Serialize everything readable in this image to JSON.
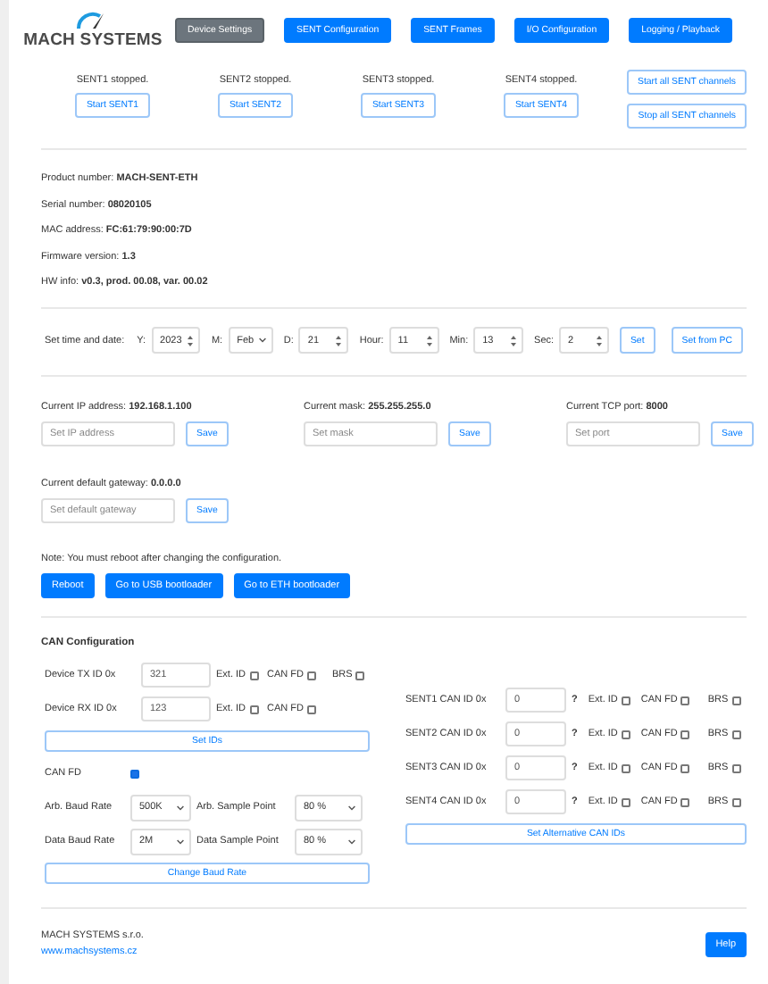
{
  "logo": {
    "name": "MACH SYSTEMS"
  },
  "nav": [
    {
      "label": "Device Settings",
      "selected": true
    },
    {
      "label": "SENT Configuration",
      "selected": false
    },
    {
      "label": "SENT Frames",
      "selected": false
    },
    {
      "label": "I/O Configuration",
      "selected": false
    },
    {
      "label": "Logging / Playback",
      "selected": false
    }
  ],
  "channels": [
    {
      "status": "SENT1 stopped.",
      "button": "Start SENT1"
    },
    {
      "status": "SENT2 stopped.",
      "button": "Start SENT2"
    },
    {
      "status": "SENT3 stopped.",
      "button": "Start SENT3"
    },
    {
      "status": "SENT4 stopped.",
      "button": "Start SENT4"
    }
  ],
  "all_buttons": [
    "Start all SENT channels",
    "Stop all SENT channels"
  ],
  "info": [
    {
      "label": "Product number:",
      "value": "MACH-SENT-ETH"
    },
    {
      "label": "Serial number:",
      "value": "08020105"
    },
    {
      "label": "MAC address:",
      "value": "FC:61:79:90:00:7D"
    },
    {
      "label": "Firmware version:",
      "value": "1.3"
    },
    {
      "label": "HW info:",
      "value": "v0.3, prod. 00.08, var. 00.02"
    }
  ],
  "time": {
    "label": "Set time and date:",
    "fields": [
      {
        "label": "Y:",
        "value": "2023",
        "kind": "number"
      },
      {
        "label": "M:",
        "value": "Feb",
        "kind": "select"
      },
      {
        "label": "D:",
        "value": "21",
        "kind": "number"
      },
      {
        "label": "Hour:",
        "value": "11",
        "kind": "number"
      },
      {
        "label": "Min:",
        "value": "13",
        "kind": "number"
      },
      {
        "label": "Sec:",
        "value": "2",
        "kind": "number"
      }
    ],
    "buttons": [
      "Set",
      "Set from PC"
    ]
  },
  "network": [
    {
      "label": "Current IP address:",
      "value": "192.168.1.100",
      "placeholder": "Set IP address",
      "button": "Save"
    },
    {
      "label": "Current mask:",
      "value": "255.255.255.0",
      "placeholder": "Set mask",
      "button": "Save"
    },
    {
      "label": "Current TCP port:",
      "value": "8000",
      "placeholder": "Set port",
      "button": "Save"
    }
  ],
  "gateway": {
    "label": "Current default gateway:",
    "value": "0.0.0.0",
    "placeholder": "Set default gateway",
    "button": "Save"
  },
  "note": "Note: You must reboot after changing the configuration.",
  "actions": [
    "Reboot",
    "Go to USB bootloader",
    "Go to ETH bootloader"
  ],
  "can": {
    "title": "CAN Configuration",
    "device_ids": [
      {
        "label": "Device TX ID 0x",
        "value": "321",
        "checks": [
          {
            "label": "Ext. ID",
            "checked": false
          },
          {
            "label": "CAN FD",
            "checked": false
          },
          {
            "label": "BRS",
            "checked": false
          }
        ]
      },
      {
        "label": "Device RX ID 0x",
        "value": "123",
        "checks": [
          {
            "label": "Ext. ID",
            "checked": false
          },
          {
            "label": "CAN FD",
            "checked": false
          }
        ]
      }
    ],
    "set_ids": "Set IDs",
    "can_fd": {
      "label": "CAN FD",
      "checked": true
    },
    "rates": [
      {
        "label": "Arb. Baud Rate",
        "value": "500K",
        "point_label": "Arb. Sample Point",
        "point": "80 %"
      },
      {
        "label": "Data Baud Rate",
        "value": "2M",
        "point_label": "Data Sample Point",
        "point": "80 %"
      }
    ],
    "change_rate": "Change Baud Rate",
    "sent_ids": [
      {
        "label": "SENT1 CAN ID 0x",
        "value": "0",
        "help": "?",
        "checks": [
          {
            "label": "Ext. ID",
            "checked": false
          },
          {
            "label": "CAN FD",
            "checked": false
          },
          {
            "label": "BRS",
            "checked": false
          }
        ]
      },
      {
        "label": "SENT2 CAN ID 0x",
        "value": "0",
        "help": "?",
        "checks": [
          {
            "label": "Ext. ID",
            "checked": false
          },
          {
            "label": "CAN FD",
            "checked": false
          },
          {
            "label": "BRS",
            "checked": false
          }
        ]
      },
      {
        "label": "SENT3 CAN ID 0x",
        "value": "0",
        "help": "?",
        "checks": [
          {
            "label": "Ext. ID",
            "checked": false
          },
          {
            "label": "CAN FD",
            "checked": false
          },
          {
            "label": "BRS",
            "checked": false
          }
        ]
      },
      {
        "label": "SENT4 CAN ID 0x",
        "value": "0",
        "help": "?",
        "checks": [
          {
            "label": "Ext. ID",
            "checked": false
          },
          {
            "label": "CAN FD",
            "checked": false
          },
          {
            "label": "BRS",
            "checked": false
          }
        ]
      }
    ],
    "set_alt": "Set Alternative CAN IDs"
  },
  "footer": {
    "company": "MACH SYSTEMS s.r.o.",
    "link": "www.machsystems.cz",
    "help": "Help"
  }
}
